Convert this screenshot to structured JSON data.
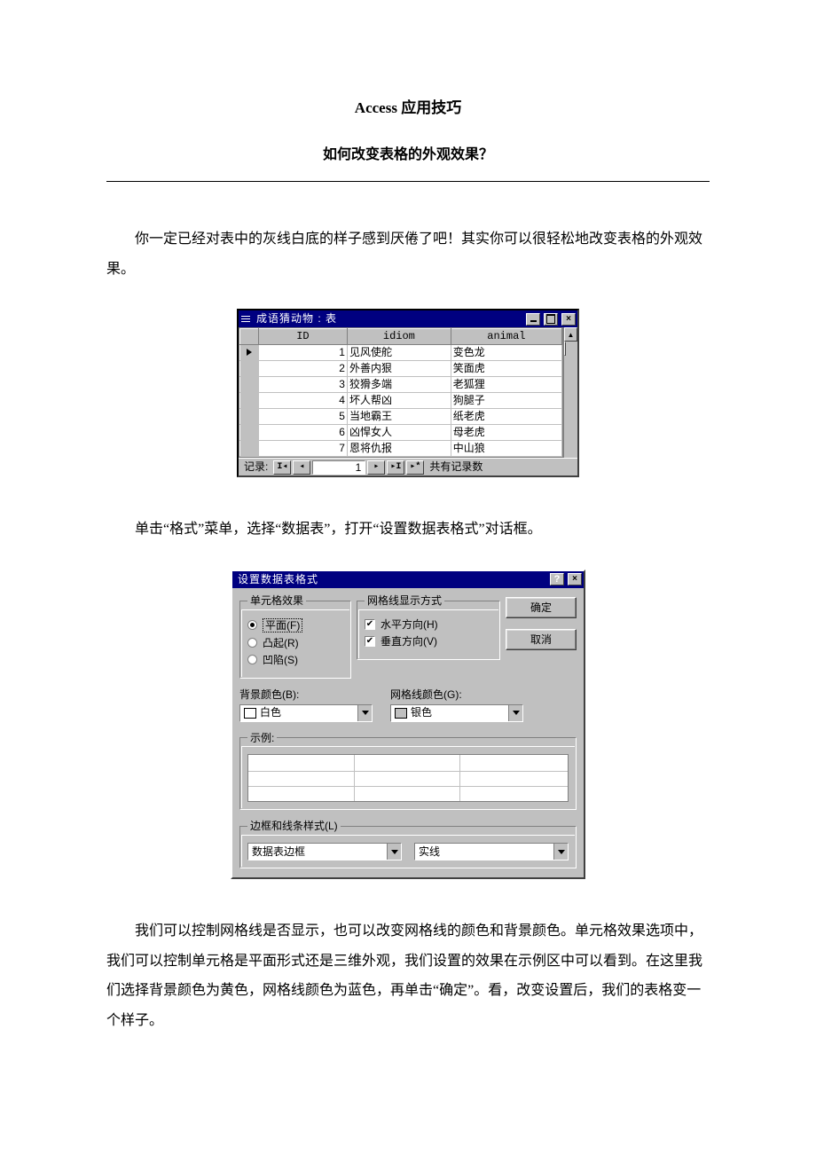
{
  "doc": {
    "title": "Access 应用技巧",
    "subtitle": "如何改变表格的外观效果？",
    "p1": "你一定已经对表中的灰线白底的样子感到厌倦了吧！其实你可以很轻松地改变表格的外观效果。",
    "p2": "单击“格式”菜单，选择“数据表”，打开“设置数据表格式”对话框。",
    "p3": "我们可以控制网格线是否显示，也可以改变网格线的颜色和背景颜色。单元格效果选项中，我们可以控制单元格是平面形式还是三维外观，我们设置的效果在示例区中可以看到。在这里我们选择背景颜色为黄色，网格线颜色为蓝色，再单击“确定”。看，改变设置后，我们的表格变一个样子。"
  },
  "datasheet": {
    "title": "成语猜动物 : 表",
    "headers": {
      "id": "ID",
      "idiom": "idiom",
      "animal": "animal"
    },
    "rows": [
      {
        "id": "1",
        "idiom": "见风使舵",
        "animal": "变色龙"
      },
      {
        "id": "2",
        "idiom": "外善内狠",
        "animal": "笑面虎"
      },
      {
        "id": "3",
        "idiom": "狡猾多端",
        "animal": "老狐狸"
      },
      {
        "id": "4",
        "idiom": "坏人帮凶",
        "animal": "狗腿子"
      },
      {
        "id": "5",
        "idiom": "当地霸王",
        "animal": "纸老虎"
      },
      {
        "id": "6",
        "idiom": "凶悍女人",
        "animal": "母老虎"
      },
      {
        "id": "7",
        "idiom": "恩将仇报",
        "animal": "中山狼"
      }
    ],
    "nav": {
      "label": "记录:",
      "current": "1",
      "total": "共有记录数"
    }
  },
  "dialog": {
    "title": "设置数据表格式",
    "cell_effect": {
      "legend": "单元格效果",
      "flat": "平面(F)",
      "raised": "凸起(R)",
      "sunken": "凹陷(S)"
    },
    "grid_show": {
      "legend": "网格线显示方式",
      "horz": "水平方向(H)",
      "vert": "垂直方向(V)"
    },
    "ok": "确定",
    "cancel": "取消",
    "bg_label": "背景颜色(B):",
    "bg_value": "白色",
    "grid_color_label": "网格线颜色(G):",
    "grid_color_value": "银色",
    "sample": "示例:",
    "border_legend": "边框和线条样式(L)",
    "border_sel": "数据表边框",
    "line_style": "实线"
  }
}
